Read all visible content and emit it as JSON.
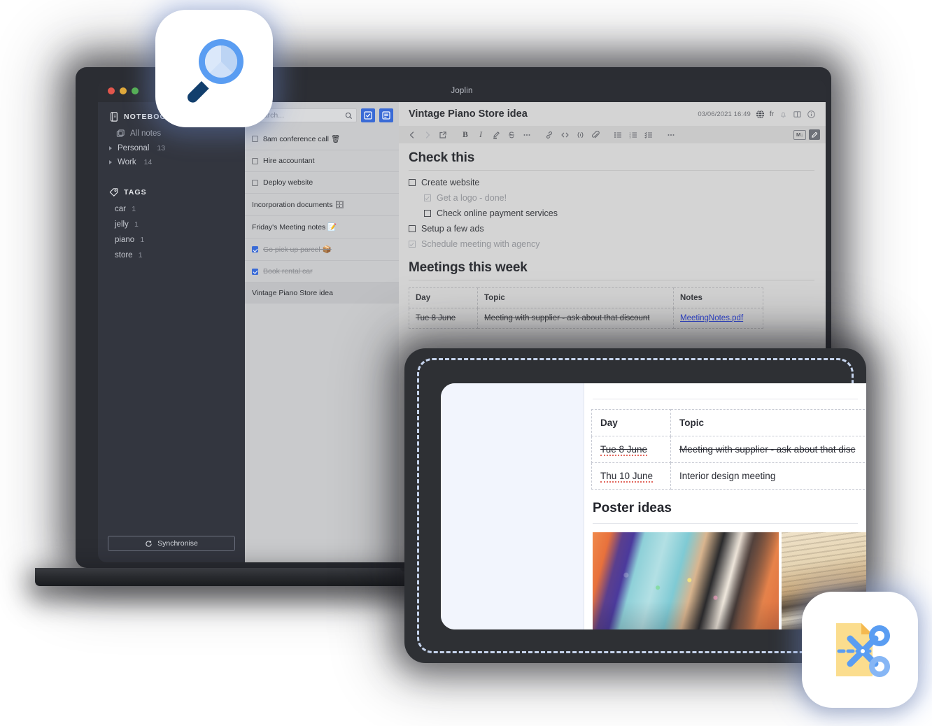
{
  "window": {
    "app_title": "Joplin",
    "traffic_lights": [
      "close",
      "minimize",
      "maximize"
    ]
  },
  "sidebar": {
    "notebooks_header": "NOTEBOOKS",
    "notebooks_icon": "notebook-icon",
    "all_notes": "All notes",
    "notebooks": [
      {
        "name": "Personal",
        "count": "13"
      },
      {
        "name": "Work",
        "count": "14"
      }
    ],
    "tags_header": "TAGS",
    "tags_icon": "tag-icon",
    "tags": [
      {
        "name": "car",
        "count": "1"
      },
      {
        "name": "jelly",
        "count": "1"
      },
      {
        "name": "piano",
        "count": "1"
      },
      {
        "name": "store",
        "count": "1"
      }
    ],
    "sync_label": "Synchronise",
    "sync_icon": "sync-icon"
  },
  "notelist": {
    "search_placeholder": "Search...",
    "search_icon": "search-icon",
    "new_todo_icon": "new-todo-icon",
    "new_note_icon": "new-note-icon",
    "items": [
      {
        "text": "8am conference call 🗑",
        "checkbox": "unchecked",
        "done": false,
        "selected": false
      },
      {
        "text": "Hire accountant",
        "checkbox": "unchecked",
        "done": false,
        "selected": false
      },
      {
        "text": "Deploy website",
        "checkbox": "unchecked",
        "done": false,
        "selected": false
      },
      {
        "text": "Incorporation documents 🗄",
        "checkbox": "none",
        "done": false,
        "selected": false
      },
      {
        "text": "Friday's Meeting notes 📝",
        "checkbox": "none",
        "done": false,
        "selected": false
      },
      {
        "text": "Go pick up parcel 📦",
        "checkbox": "checked",
        "done": true,
        "selected": false
      },
      {
        "text": "Book rental car",
        "checkbox": "checked",
        "done": true,
        "selected": false
      },
      {
        "text": "Vintage Piano Store idea",
        "checkbox": "none",
        "done": false,
        "selected": true
      }
    ]
  },
  "editor": {
    "note_title": "Vintage Piano Store idea",
    "note_date": "03/06/2021 16:49",
    "language_icon": "globe-icon",
    "language_code": "fr",
    "alarm_icon": "bell-icon",
    "layout_icon": "split-layout-icon",
    "info_icon": "info-icon",
    "toolbar": [
      {
        "name": "back-icon",
        "label": "<"
      },
      {
        "name": "forward-icon",
        "label": ">"
      },
      {
        "name": "external-link-icon",
        "label": "open"
      },
      {
        "name": "bold-icon",
        "label": "B"
      },
      {
        "name": "italic-icon",
        "label": "I"
      },
      {
        "name": "highlight-icon",
        "label": "highlight"
      },
      {
        "name": "strikethrough-icon",
        "label": "S"
      },
      {
        "name": "more-format-icon",
        "label": "..."
      },
      {
        "name": "link-icon",
        "label": "link"
      },
      {
        "name": "code-icon",
        "label": "<>"
      },
      {
        "name": "code-block-icon",
        "label": "{;}"
      },
      {
        "name": "attach-icon",
        "label": "attach"
      },
      {
        "name": "bulleted-list-icon",
        "label": "ul"
      },
      {
        "name": "numbered-list-icon",
        "label": "ol"
      },
      {
        "name": "checkbox-list-icon",
        "label": "todo"
      },
      {
        "name": "more-options-icon",
        "label": "..."
      }
    ],
    "markdown_badge": "M↓",
    "edit_badge_icon": "edit-pencil-icon",
    "heading_1": "Check this",
    "checklist": [
      {
        "text": "Create website",
        "checked": false,
        "indent": 0
      },
      {
        "text": "Get a logo - done!",
        "checked": true,
        "indent": 1
      },
      {
        "text": "Check online payment services",
        "checked": false,
        "indent": 1
      },
      {
        "text": "Setup a few ads",
        "checked": false,
        "indent": 0
      },
      {
        "text": "Schedule meeting with agency",
        "checked": true,
        "indent": 0
      }
    ],
    "heading_2": "Meetings this week",
    "table": {
      "headers": [
        "Day",
        "Topic",
        "Notes"
      ],
      "rows": [
        {
          "day": "Tue 8 June",
          "topic": "Meeting with supplier - ask about that discount",
          "notes": "MeetingNotes.pdf",
          "strikethrough": true,
          "notes_is_link": true
        }
      ]
    }
  },
  "tablet": {
    "table": {
      "headers": [
        "Day",
        "Topic"
      ],
      "rows": [
        {
          "day": "Tue 8 June",
          "topic": "Meeting with supplier - ask about that disc",
          "strikethrough": true,
          "spellcheck": true
        },
        {
          "day": "Thu 10 June",
          "topic": "Interior design meeting",
          "strikethrough": false,
          "spellcheck": true
        }
      ]
    },
    "heading": "Poster ideas",
    "images": [
      {
        "name": "colorful-painted-piano-photo",
        "alt": "Colorful painted upright piano keyboard"
      },
      {
        "name": "sepia-grand-piano-photo",
        "alt": "Sepia toned grand piano strings"
      }
    ]
  },
  "floating_icons": [
    {
      "name": "search-app-icon",
      "description": "magnifying glass"
    },
    {
      "name": "clipper-app-icon",
      "description": "document with scissors"
    }
  ],
  "colors": {
    "sidebar_bg": "#33363f",
    "notelist_bg": "#c9cacc",
    "editor_bg": "#d4d4d4",
    "accent_blue": "#3a6bd6",
    "link_blue": "#2f45d4",
    "tablet_frame": "#2e3034",
    "dash_border": "#c5d3ec"
  }
}
